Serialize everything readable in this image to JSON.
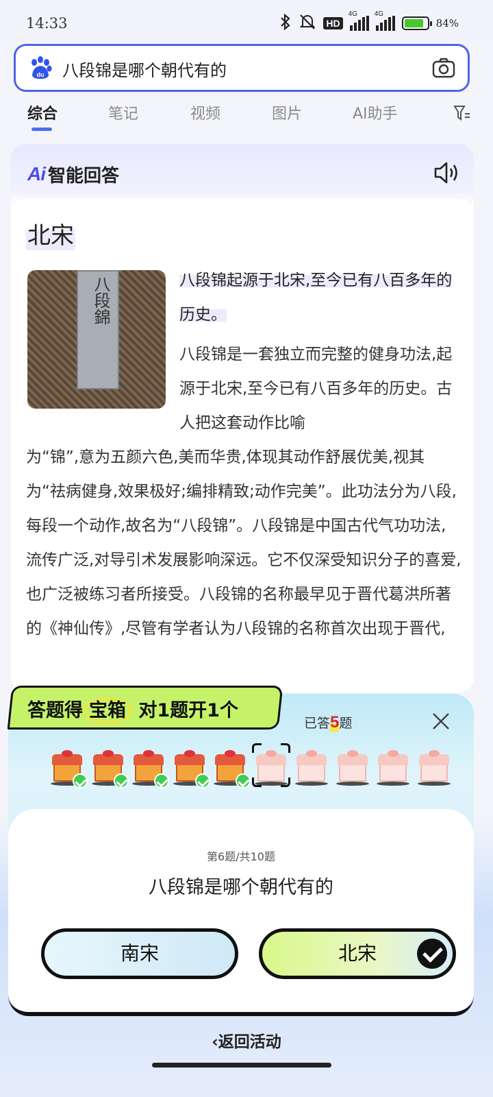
{
  "status_bar": {
    "time": "14:33",
    "battery_percent": "84%",
    "battery_level": 0.84,
    "network": "4G",
    "hd_label": "HD"
  },
  "search": {
    "query": "八段锦是哪个朝代有的",
    "logo_text": "du",
    "logo_color": "#2f54eb"
  },
  "tabs": [
    {
      "label": "综合",
      "active": true
    },
    {
      "label": "笔记"
    },
    {
      "label": "视频"
    },
    {
      "label": "图片"
    },
    {
      "label": "AI助手"
    }
  ],
  "ai_answer": {
    "logo": "Ai",
    "title": "智能回答",
    "answer_title": "北宋",
    "image_caption": "八段錦",
    "highlight": "八段锦起源于北宋,至今已有八百多年的历史。",
    "paragraph_right": "八段锦是一套独立而完整的健身功法,起源于北宋,至今已有八百多年的历史。古人把这套动作比喻",
    "paragraph_full": "为“锦”,意为五颜六色,美而华贵,体现其动作舒展优美,视其为“祛病健身,效果极好;编排精致;动作完美”。此功法分为八段,每段一个动作,故名为“八段锦”。八段锦是中国古代气功功法,流传广泛,对导引术发展影响深远。它不仅深受知识分子的喜爱,也广泛被练习者所接受。八段锦的名称最早见于晋代葛洪所著的《神仙传》,尽管有学者认为八段锦的名称首次出现于晋代,"
  },
  "quiz": {
    "banner_part1": "答题得",
    "banner_circled": "宝箱",
    "banner_part2": " 对1题开1个",
    "answered_prefix": "已答",
    "answered_count": "5",
    "answered_suffix": "题",
    "chests_total": 10,
    "chests_opened": 5,
    "current_index": 6,
    "progress_current": "第6题",
    "progress_total": "/共10题",
    "question": "八段锦是哪个朝代有的",
    "options": [
      {
        "label": "南宋",
        "selected": false
      },
      {
        "label": "北宋",
        "selected": true
      }
    ]
  },
  "footer": {
    "back_label": "返回活动"
  },
  "colors": {
    "accent": "#4e6ef2",
    "ai_purple": "#4b4df0",
    "banner_green": "#c6f26a",
    "answered_red": "#e0242b"
  }
}
